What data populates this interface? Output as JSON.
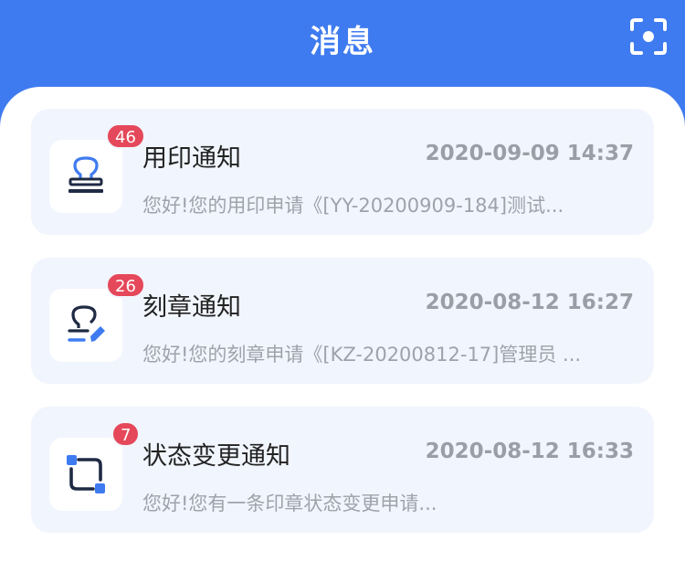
{
  "header": {
    "title": "消息",
    "scan_icon": "scan-icon"
  },
  "colors": {
    "brand": "#3f7bf0",
    "badge": "#e5485a",
    "card_bg": "#f1f5fd"
  },
  "messages": [
    {
      "title": "用印通知",
      "time": "2020-09-09 14:37",
      "preview": "您好!您的用印申请《[YY-20200909-184]测试...",
      "badge": "46",
      "icon": "stamp-icon"
    },
    {
      "title": "刻章通知",
      "time": "2020-08-12 16:27",
      "preview": "您好!您的刻章申请《[KZ-20200812-17]管理员 ...",
      "badge": "26",
      "icon": "stamp-edit-icon"
    },
    {
      "title": "状态变更通知",
      "time": "2020-08-12 16:33",
      "preview": "您好!您有一条印章状态变更申请...",
      "badge": "7",
      "icon": "status-change-icon"
    }
  ]
}
